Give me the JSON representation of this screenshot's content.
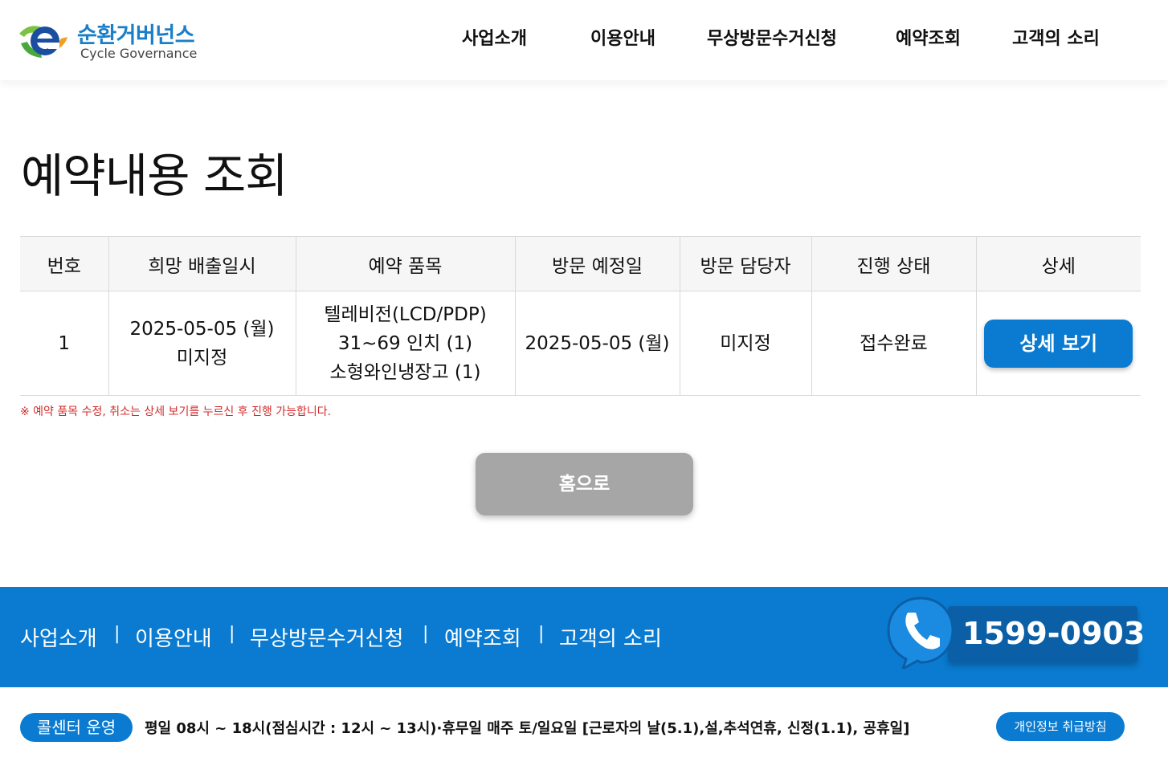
{
  "header": {
    "logo_ko": "순환거버넌스",
    "logo_en": "Cycle Governance",
    "nav": [
      "사업소개",
      "이용안내",
      "무상방문수거신청",
      "예약조회",
      "고객의 소리"
    ]
  },
  "page_title": "예약내용 조회",
  "table": {
    "headers": [
      "번호",
      "희망 배출일시",
      "예약 품목",
      "방문 예정일",
      "방문 담당자",
      "진행 상태",
      "상세"
    ],
    "rows": [
      {
        "no": "1",
        "wish_date": "2025-05-05 (월)",
        "wish_time": "미지정",
        "item_1": "텔레비전(LCD/PDP)",
        "item_2": "31~69 인치 (1)",
        "item_3": "소형와인냉장고 (1)",
        "visit_date": "2025-05-05 (월)",
        "manager": "미지정",
        "status": "접수완료",
        "detail_label": "상세 보기"
      }
    ]
  },
  "notice": "※ 예약 품목 수정, 취소는 상세 보기를 누르신 후 진행 가능합니다.",
  "home_label": "홈으로",
  "footer": {
    "nav": [
      "사업소개",
      "이용안내",
      "무상방문수거신청",
      "예약조회",
      "고객의 소리"
    ],
    "separator": "|",
    "phone": "1599-0903",
    "callcenter_label": "콜센터 운영",
    "hours": "평일 08시 ~ 18시(점심시간 : 12시 ~ 13시)·휴무일 매주 토/일요일  [근로자의 날(5.1),설,추석연휴, 신정(1.1), 공휴일]",
    "privacy_label": "개인정보 취급방침"
  },
  "colors": {
    "primary_blue": "#0a7bd0",
    "status_blue": "#2a5fb0",
    "notice_red": "#d12c2c",
    "home_gray": "#a6a6a6"
  }
}
